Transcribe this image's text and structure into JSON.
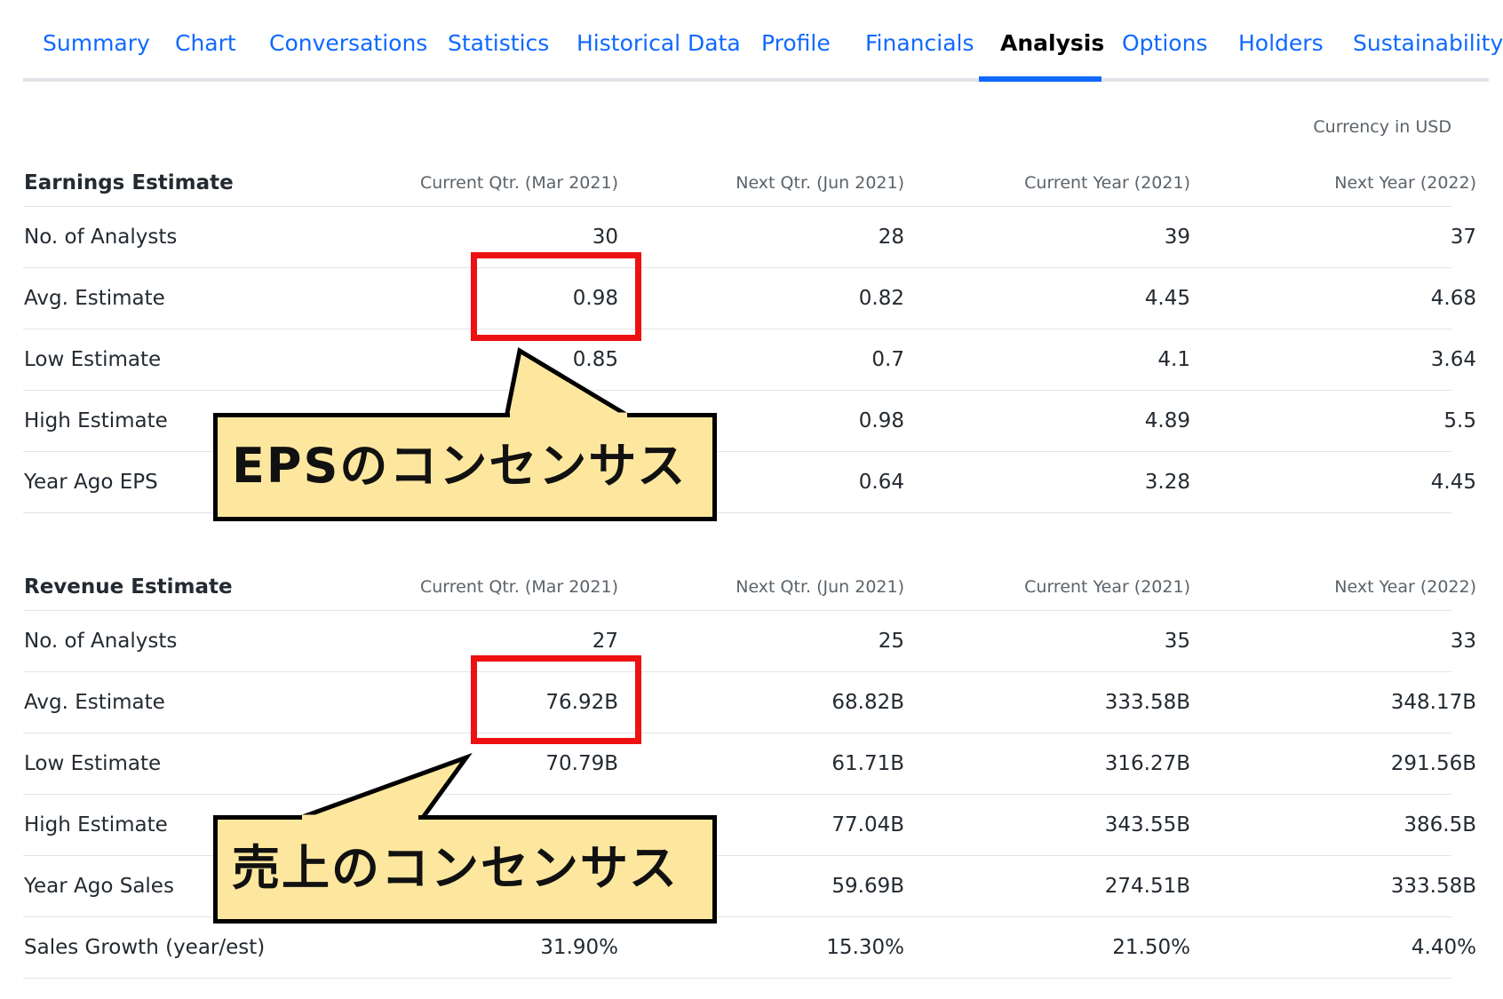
{
  "tabs": [
    {
      "label": "Summary"
    },
    {
      "label": "Chart"
    },
    {
      "label": "Conversations"
    },
    {
      "label": "Statistics"
    },
    {
      "label": "Historical Data"
    },
    {
      "label": "Profile"
    },
    {
      "label": "Financials"
    },
    {
      "label": "Analysis",
      "active": true
    },
    {
      "label": "Options"
    },
    {
      "label": "Holders"
    },
    {
      "label": "Sustainability"
    }
  ],
  "currency_note": "Currency in USD",
  "earnings": {
    "title": "Earnings Estimate",
    "columns": [
      "Current Qtr. (Mar 2021)",
      "Next Qtr. (Jun 2021)",
      "Current Year (2021)",
      "Next Year (2022)"
    ],
    "rows": [
      {
        "label": "No. of Analysts",
        "values": [
          "30",
          "28",
          "39",
          "37"
        ]
      },
      {
        "label": "Avg. Estimate",
        "values": [
          "0.98",
          "0.82",
          "4.45",
          "4.68"
        ]
      },
      {
        "label": "Low Estimate",
        "values": [
          "0.85",
          "0.7",
          "4.1",
          "3.64"
        ]
      },
      {
        "label": "High Estimate",
        "values": [
          "",
          "0.98",
          "4.89",
          "5.5"
        ]
      },
      {
        "label": "Year Ago EPS",
        "values": [
          "",
          "0.64",
          "3.28",
          "4.45"
        ]
      }
    ]
  },
  "revenue": {
    "title": "Revenue Estimate",
    "columns": [
      "Current Qtr. (Mar 2021)",
      "Next Qtr. (Jun 2021)",
      "Current Year (2021)",
      "Next Year (2022)"
    ],
    "rows": [
      {
        "label": "No. of Analysts",
        "values": [
          "27",
          "25",
          "35",
          "33"
        ]
      },
      {
        "label": "Avg. Estimate",
        "values": [
          "76.92B",
          "68.82B",
          "333.58B",
          "348.17B"
        ]
      },
      {
        "label": "Low Estimate",
        "values": [
          "70.79B",
          "61.71B",
          "316.27B",
          "291.56B"
        ]
      },
      {
        "label": "High Estimate",
        "values": [
          "",
          "77.04B",
          "343.55B",
          "386.5B"
        ]
      },
      {
        "label": "Year Ago Sales",
        "values": [
          "",
          "59.69B",
          "274.51B",
          "333.58B"
        ]
      },
      {
        "label": "Sales Growth (year/est)",
        "values": [
          "31.90%",
          "15.30%",
          "21.50%",
          "4.40%"
        ]
      }
    ]
  },
  "annotations": {
    "eps_callout": "EPSのコンセンサス",
    "revenue_callout": "売上のコンセンサス",
    "highlight_color": "#ee1111",
    "callout_fill": "#fde79e"
  },
  "colors": {
    "link": "#0f69ff",
    "text": "#232a31",
    "muted": "#5b636a",
    "divider": "#e0e4e9"
  }
}
